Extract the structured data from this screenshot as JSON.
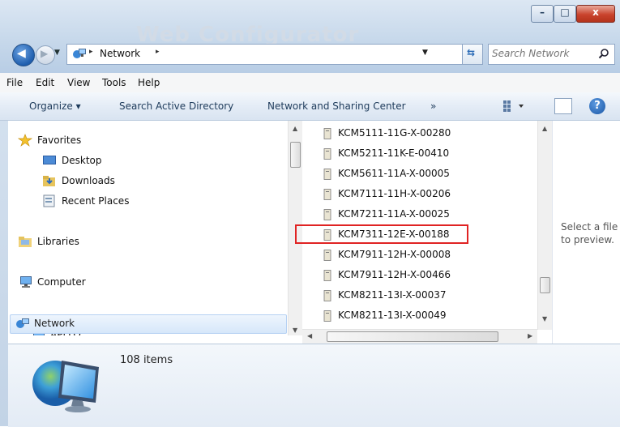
{
  "window": {
    "title_ghost": "Web Configurator",
    "controls": {
      "minimize": "–",
      "maximize": "□",
      "close": "x"
    }
  },
  "navigation": {
    "back_icon": "back-arrow-icon",
    "forward_icon": "forward-arrow-icon",
    "address": {
      "location": "Network",
      "separator": "▸"
    },
    "refresh_icon": "refresh-icon",
    "search": {
      "placeholder": "Search Network"
    }
  },
  "menubar": {
    "items": [
      "File",
      "Edit",
      "View",
      "Tools",
      "Help"
    ]
  },
  "toolbar": {
    "organize": "Organize ▾",
    "search_ad": "Search Active Directory",
    "network_sharing": "Network and Sharing Center",
    "more": "»",
    "views_icon": "views-icon",
    "preview_icon": "preview-pane-icon",
    "help": "?"
  },
  "navpane": {
    "favorites": {
      "label": "Favorites",
      "items": [
        "Desktop",
        "Downloads",
        "Recent Places"
      ]
    },
    "libraries": "Libraries",
    "computer": "Computer",
    "network": "Network",
    "network_child": "APLLO"
  },
  "files": {
    "items": [
      "KCM5111-11G-X-00280",
      "KCM5211-11K-E-00410",
      "KCM5611-11A-X-00005",
      "KCM7111-11H-X-00206",
      "KCM7211-11A-X-00025",
      "KCM7311-12E-X-00188",
      "KCM7911-12H-X-00008",
      "KCM7911-12H-X-00466",
      "KCM8211-13I-X-00037",
      "KCM8211-13I-X-00049"
    ],
    "highlighted": "KCM7311-12E-X-00188"
  },
  "preview": {
    "message_line1": "Select a file",
    "message_line2": "to preview."
  },
  "details": {
    "item_count": "108 items"
  },
  "colors": {
    "highlight": "#e02323",
    "accent": "#1f5eae",
    "selection": "#d6e7fa"
  }
}
